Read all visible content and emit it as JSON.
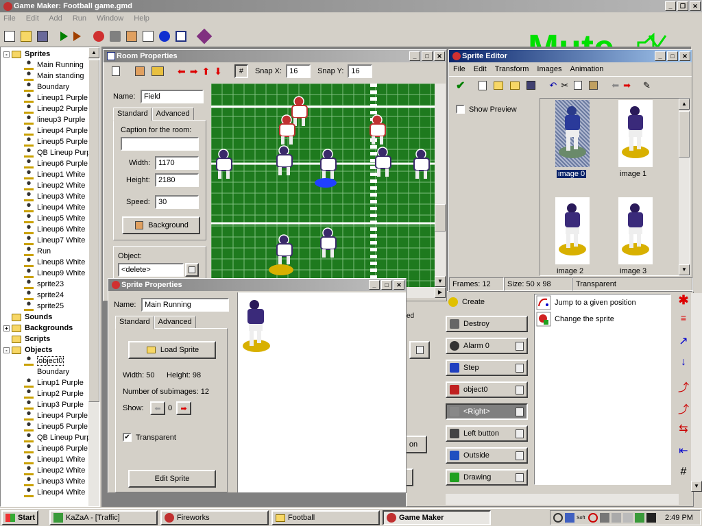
{
  "app": {
    "title": "Game Maker: Football game.gmd"
  },
  "menu": [
    "File",
    "Edit",
    "Add",
    "Run",
    "Window",
    "Help"
  ],
  "mute_overlay": "Mute",
  "tree": {
    "sprites_label": "Sprites",
    "sprites": [
      "Main Running",
      "Main standing",
      "Boundary",
      "Lineup1 Purple",
      "Lineup2 Purple",
      "lineup3 Purple",
      "Lineup4 Purple",
      "Lineup5 Purple",
      "QB Lineup Purple",
      "Lineup6 Purple",
      "Lineup1 White",
      "Lineup2 White",
      "Lineup3 White",
      "Lineup4 White",
      "Lineup5 White",
      "Lineup6 White",
      "Lineup7 White",
      "Run",
      "Lineup8 White",
      "Lineup9 White",
      "sprite23",
      "sprite24",
      "sprite25"
    ],
    "sounds_label": "Sounds",
    "backgrounds_label": "Backgrounds",
    "scripts_label": "Scripts",
    "objects_label": "Objects",
    "objects": [
      "object0",
      "Boundary",
      "Linup1 Purple",
      "Linup2 Purple",
      "Linup3 Purple",
      "Lineup4 Purple",
      "Lineup5 Purple",
      "QB Lineup Purple",
      "Lineup6 Purple",
      "Lineup1 White",
      "Lineup2 White",
      "Lineup3 White",
      "Lineup4 White"
    ]
  },
  "room": {
    "title": "Room Properties",
    "snap_x_label": "Snap X:",
    "snap_x": "16",
    "snap_y_label": "Snap Y:",
    "snap_y": "16",
    "name_label": "Name:",
    "name": "Field",
    "tab_standard": "Standard",
    "tab_advanced": "Advanced",
    "caption_label": "Caption for the room:",
    "caption": "",
    "width_label": "Width:",
    "width": "1170",
    "height_label": "Height:",
    "height": "2180",
    "speed_label": "Speed:",
    "speed": "30",
    "background_btn": "Background",
    "object_label": "Object:",
    "object_value": "<delete>"
  },
  "sprite_editor": {
    "title": "Sprite Editor",
    "menu": [
      "File",
      "Edit",
      "Transform",
      "Images",
      "Animation"
    ],
    "show_preview": "Show Preview",
    "frames": [
      {
        "label": "image 0",
        "selected": true
      },
      {
        "label": "image 1",
        "selected": false
      },
      {
        "label": "image 2",
        "selected": false
      },
      {
        "label": "image 3",
        "selected": false
      }
    ],
    "status_frames": "Frames: 12",
    "status_size": "Size: 50 x 98",
    "status_transparent": "Transparent"
  },
  "sprite_props": {
    "title": "Sprite Properties",
    "name_label": "Name:",
    "name": "Main Running",
    "tab_standard": "Standard",
    "tab_advanced": "Advanced",
    "load_sprite": "Load Sprite",
    "width_text": "Width: 50",
    "height_text": "Height: 98",
    "subimages": "Number of subimages: 12",
    "show_label": "Show:",
    "show_value": "0",
    "transparent_label": "Transparent",
    "edit_sprite": "Edit Sprite"
  },
  "object_window": {
    "partial_tab": "ed",
    "partial_btn": "on",
    "events": [
      "Create",
      "Destroy",
      "Alarm 0",
      "Step",
      "object0",
      "<Right>",
      "Left button",
      "Outside",
      "Drawing"
    ],
    "actions": [
      "Jump to a given position",
      "Change the sprite"
    ]
  },
  "taskbar": {
    "start": "Start",
    "tasks": [
      "KaZaA - [Traffic]",
      "Fireworks",
      "Football",
      "Game Maker"
    ],
    "tray_text": "Soft",
    "clock": "2:49 PM"
  },
  "colors": {
    "title_active": "#0a246a",
    "field_green": "#1e7a1e",
    "mute_green": "#00e000"
  }
}
